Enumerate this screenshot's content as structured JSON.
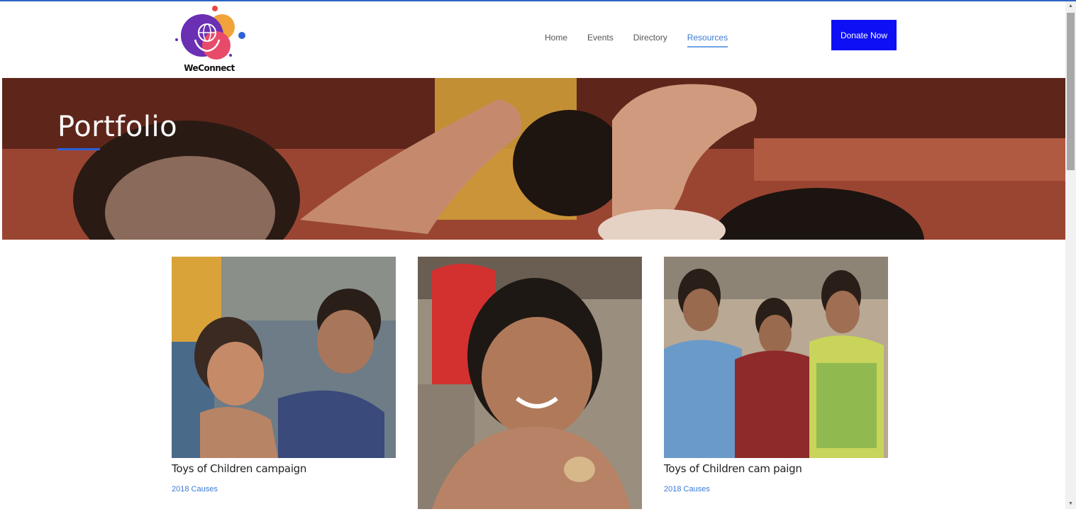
{
  "brand": {
    "name": "WeConnect",
    "logo_icon": "globe-in-hands-icon",
    "accent": "#0f0ff5"
  },
  "nav": {
    "items": [
      {
        "label": "Home",
        "active": false
      },
      {
        "label": "Events",
        "active": false
      },
      {
        "label": "Directory",
        "active": false
      },
      {
        "label": "Resources",
        "active": true
      }
    ],
    "donate_label": "Donate Now"
  },
  "hero": {
    "title": "Portfolio"
  },
  "portfolio": {
    "cards": [
      {
        "title": "Toys of Children campaign",
        "meta": "2018 Causes"
      },
      {
        "title": "",
        "meta": ""
      },
      {
        "title": "Toys of Children cam paign",
        "meta": "2018 Causes"
      }
    ]
  },
  "colors": {
    "active_nav": "#3a7bd5",
    "hero_underline": "#2a62d8"
  }
}
